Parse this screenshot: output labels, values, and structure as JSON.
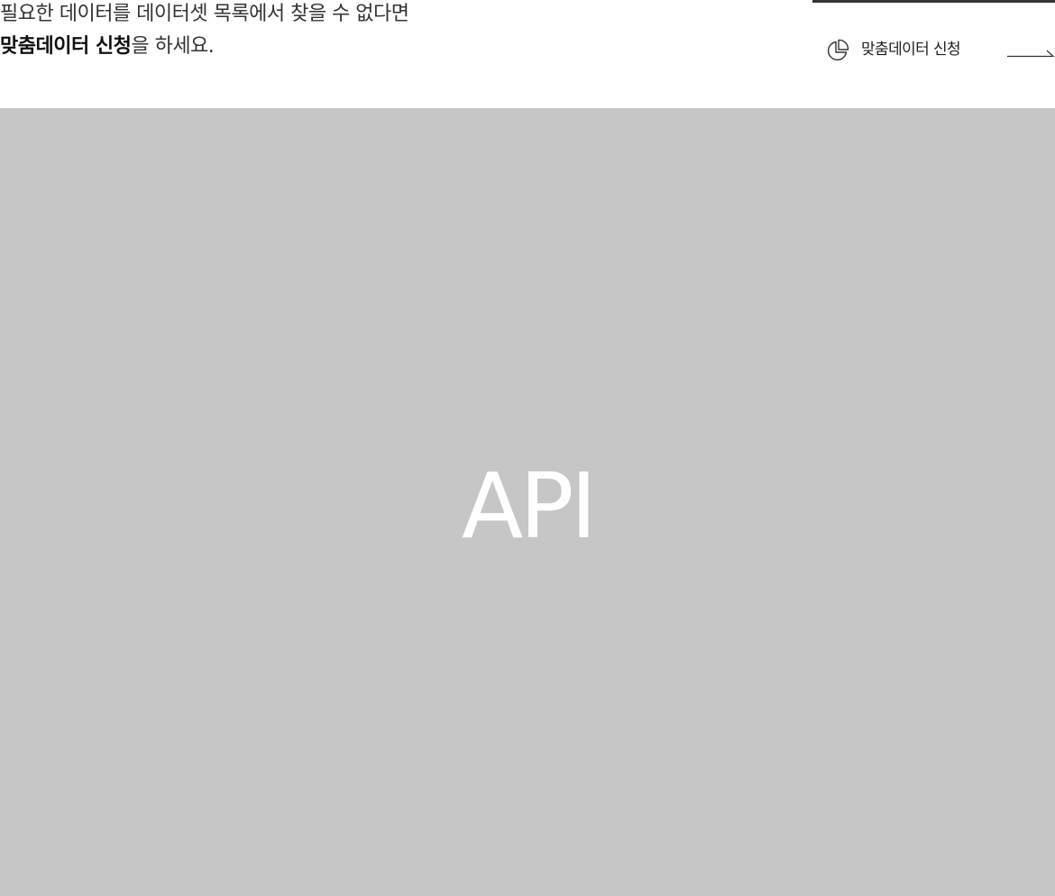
{
  "notice": {
    "line1": "필요한 데이터를 데이터셋 목록에서 찾을 수 없다면",
    "line2_strong": "맞춤데이터 신청",
    "line2_rest": "을 하세요."
  },
  "custom_request_link": {
    "label": "맞춤데이터 신청",
    "icon": "pie-chart-icon",
    "arrow_icon": "arrow-right-icon"
  },
  "banner": {
    "text": "API",
    "background": "#c6c6c6",
    "text_color": "#ffffff"
  },
  "colors": {
    "accent_line": "#333333"
  }
}
